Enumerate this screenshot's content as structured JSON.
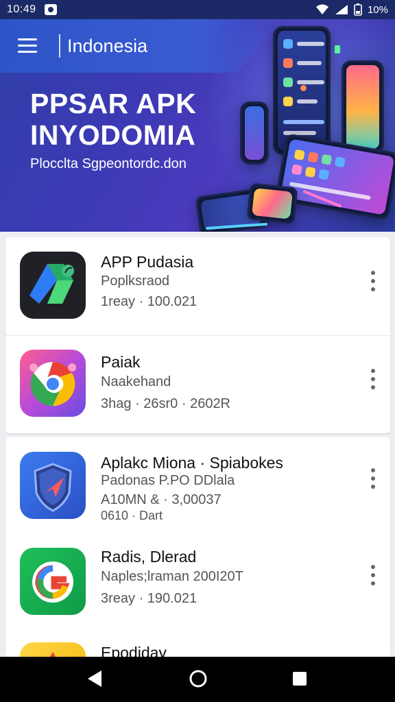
{
  "status": {
    "time": "10:49",
    "battery": "10%",
    "icons": [
      "notification-icon",
      "wifi-icon",
      "signal-icon",
      "battery-icon"
    ]
  },
  "header": {
    "menu_icon": "hamburger-menu-icon",
    "country": "Indonesia"
  },
  "banner": {
    "title_line1": "PPSAR APK",
    "title_line2": "INYODOMIA",
    "subtitle": "Plocclta Sgpeontordc.don"
  },
  "apps_card1": [
    {
      "name": "APP Pudasia",
      "line1": "Poplksraod",
      "line2": "1reay · 100.021",
      "icon": "app-drive-icon"
    },
    {
      "name": "Paiak",
      "line1": "Naakehand",
      "line2": "3hag · 26sr0 · 2602R",
      "icon": "chrome-icon"
    }
  ],
  "apps_card2": [
    {
      "name": "Aplakc Miona · Spiabokes",
      "line1": "Padonas P.PO DDlala",
      "line2": "A10MN & · 3,00037",
      "line3": "0610 · Dart",
      "icon": "shield-icon"
    },
    {
      "name": "Radis, Dlerad",
      "line1": "Naples;lraman 200I20T",
      "line2": "3reay · 190.021",
      "icon": "google-icon"
    },
    {
      "name": "Epodiday",
      "icon": "yellow-app-icon"
    }
  ],
  "nav": {
    "back_icon": "back-icon",
    "home_icon": "home-icon",
    "recents_icon": "recents-icon"
  },
  "colors": {
    "banner_start": "#2f3fa8",
    "banner_end": "#4b3bbd",
    "status_bar": "#1b2a66"
  }
}
